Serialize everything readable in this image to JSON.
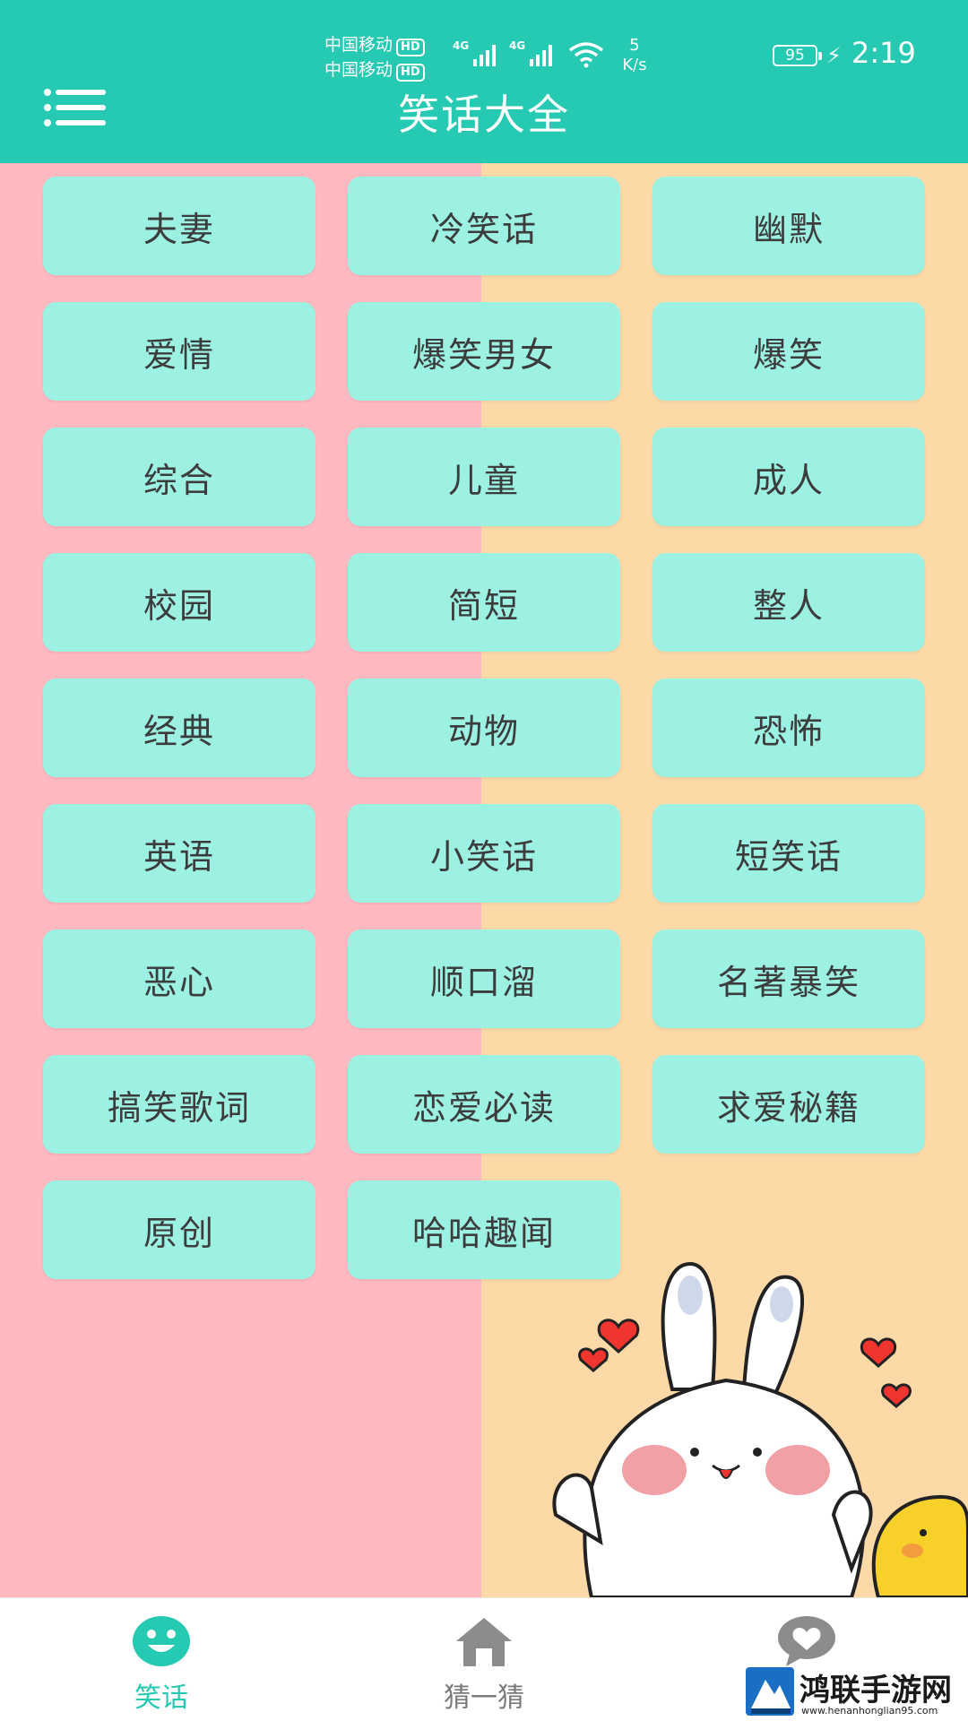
{
  "status_bar": {
    "carrier1": "中国移动",
    "carrier2": "中国移动",
    "hd_badge": "HD",
    "network1": "4G",
    "network2": "4G",
    "net_speed_value": "5",
    "net_speed_unit": "K/s",
    "battery": "95",
    "time": "2:19"
  },
  "header": {
    "title": "笑话大全",
    "menu_icon": "hamburger-menu-icon",
    "background_color": "#26c9b1"
  },
  "categories": [
    "夫妻",
    "冷笑话",
    "幽默",
    "爱情",
    "爆笑男女",
    "爆笑",
    "综合",
    "儿童",
    "成人",
    "校园",
    "简短",
    "整人",
    "经典",
    "动物",
    "恐怖",
    "英语",
    "小笑话",
    "短笑话",
    "恶心",
    "顺口溜",
    "名著暴笑",
    "搞笑歌词",
    "恋爱必读",
    "求爱秘籍",
    "原创",
    "哈哈趣闻"
  ],
  "tabs": [
    {
      "label": "笑话",
      "icon": "smiley-face-icon",
      "active": true
    },
    {
      "label": "猜一猜",
      "icon": "house-icon",
      "active": false
    },
    {
      "label": "",
      "icon": "chat-heart-icon",
      "active": false
    }
  ],
  "colors": {
    "accent": "#26c9b1",
    "button": "#9cf1e3",
    "bg_left": "#feb8c0",
    "bg_right": "#fdd9a8"
  },
  "watermark": {
    "name": "鸿联手游网",
    "url": "www.henanhonglian95.com"
  }
}
